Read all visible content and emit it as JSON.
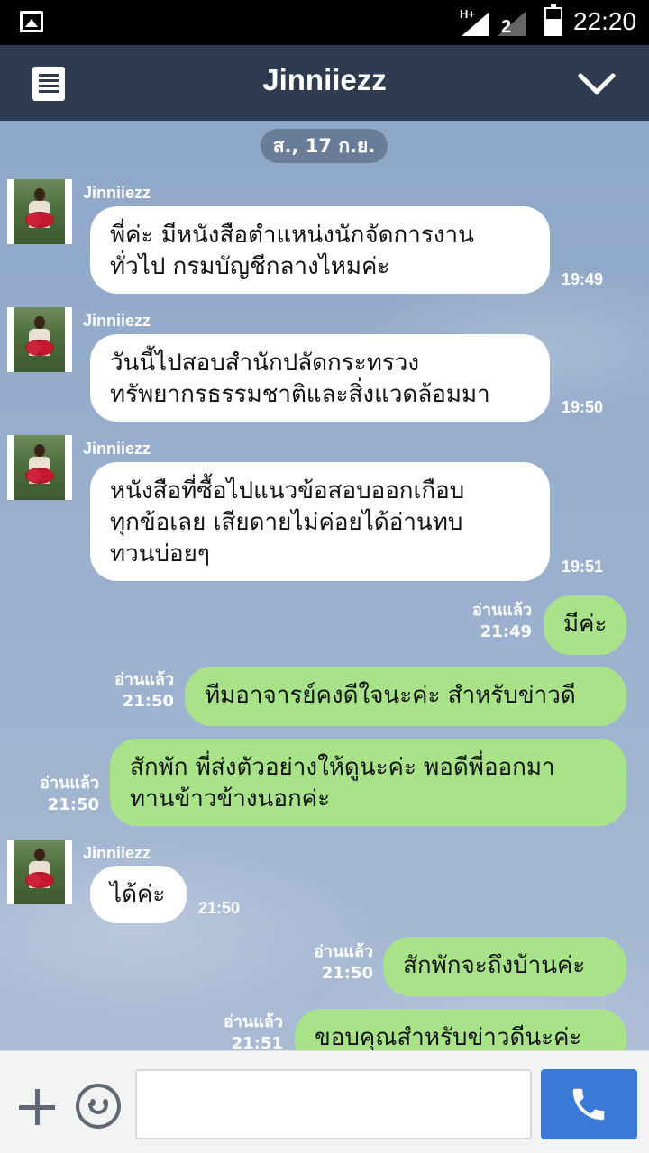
{
  "status_bar": {
    "network": "H+",
    "sim_label": "2",
    "time": "22:20"
  },
  "header": {
    "title": "Jinniiezz",
    "icons": [
      "menu-icon",
      "chevron-down-icon"
    ]
  },
  "chat": {
    "date": "ส., 17 ก.ย.",
    "incoming": [
      {
        "sender": "Jinniiezz",
        "lines": [
          "พี่ค่ะ มีหนังสือตำแหน่งนักจัดการงาน",
          "ทั่วไป กรมบัญชีกลางไหมค่ะ"
        ],
        "time": "19:49"
      },
      {
        "sender": "Jinniiezz",
        "lines": [
          "วันนี้ไปสอบสำนักปลัดกระทรวง",
          "ทรัพยากรธรรมชาติและสิ่งแวดล้อมมา"
        ],
        "time": "19:50"
      },
      {
        "sender": "Jinniiezz",
        "lines": [
          "หนังสือที่ซื้อไปแนวข้อสอบออกเกือบ",
          "ทุกข้อเลย เสียดายไม่ค่อยได้อ่านทบ",
          "ทวนบ่อยๆ"
        ],
        "time": "19:51"
      },
      {
        "sender": "Jinniiezz",
        "lines": [
          "ได้ค่ะ"
        ],
        "time": "21:50"
      }
    ],
    "outgoing": [
      {
        "read": "อ่านแล้ว",
        "time": "21:49",
        "lines": [
          "มีค่ะ"
        ]
      },
      {
        "read": "อ่านแล้ว",
        "time": "21:50",
        "lines": [
          "ทีมอาจารย์คงดีใจนะค่ะ สำหรับข่าวดี"
        ]
      },
      {
        "read": "อ่านแล้ว",
        "time": "21:50",
        "lines": [
          "สักพัก พี่ส่งตัวอย่างให้ดูนะค่ะ พอดีพี่ออกมา",
          "ทานข้าวข้างนอกค่ะ"
        ]
      },
      {
        "read": "อ่านแล้ว",
        "time": "21:50",
        "lines": [
          "สักพักจะถึงบ้านค่ะ"
        ]
      },
      {
        "read": "อ่านแล้ว",
        "time": "21:51",
        "lines": [
          "ขอบคุณสำหรับข่าวดีนะค่ะ"
        ]
      }
    ]
  },
  "input_bar": {
    "placeholder": "",
    "icons": [
      "plus-icon",
      "emoji-icon",
      "phone-icon"
    ]
  },
  "colors": {
    "header": "#2e3b50",
    "outgoing_bubble": "#a8e38a",
    "incoming_bubble": "#ffffff",
    "call_button": "#3c7ad8",
    "date_pill": "#6a7d98"
  }
}
